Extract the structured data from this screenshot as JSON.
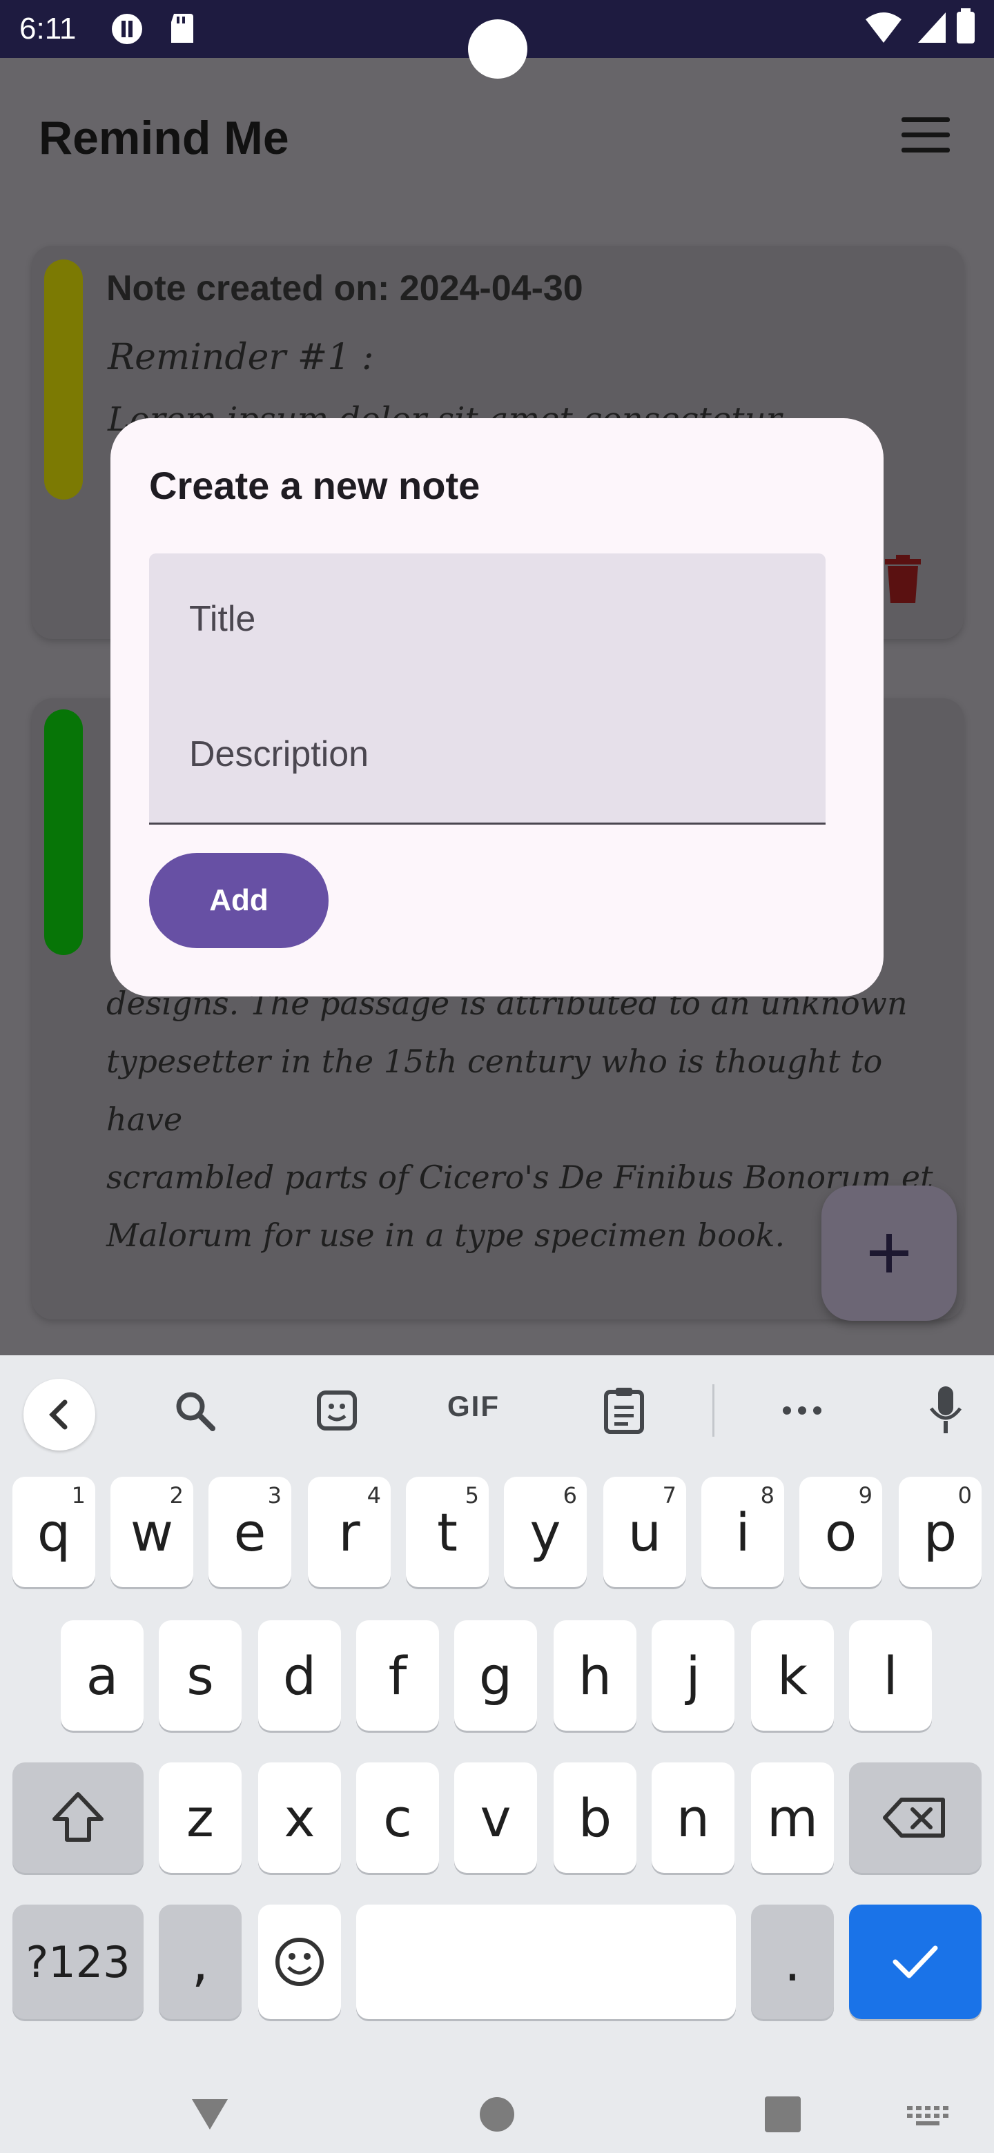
{
  "status_bar": {
    "time": "6:11"
  },
  "app": {
    "title": "Remind Me"
  },
  "notes": [
    {
      "heading": "Note created on: 2024-04-30",
      "reminder_label": "Reminder #1 :",
      "text": "Lorem ipsum dolor sit amet consectetur...",
      "color": "#7c7a03"
    },
    {
      "color": "#077507",
      "text_lines": [
        "designs. The passage is attributed to an unknown",
        "typesetter in the 15th century who is thought to have",
        "scrambled parts of Cicero's De Finibus Bonorum et",
        "Malorum for use in a type specimen book."
      ]
    }
  ],
  "fab": {
    "icon": "plus-icon",
    "label": "+"
  },
  "dialog": {
    "title": "Create a new note",
    "title_placeholder": "Title",
    "description_placeholder": "Description",
    "add_label": "Add"
  },
  "keyboard": {
    "gif_label": "GIF",
    "row1": [
      {
        "key": "q",
        "hint": "1"
      },
      {
        "key": "w",
        "hint": "2"
      },
      {
        "key": "e",
        "hint": "3"
      },
      {
        "key": "r",
        "hint": "4"
      },
      {
        "key": "t",
        "hint": "5"
      },
      {
        "key": "y",
        "hint": "6"
      },
      {
        "key": "u",
        "hint": "7"
      },
      {
        "key": "i",
        "hint": "8"
      },
      {
        "key": "o",
        "hint": "9"
      },
      {
        "key": "p",
        "hint": "0"
      }
    ],
    "row2": [
      "a",
      "s",
      "d",
      "f",
      "g",
      "h",
      "j",
      "k",
      "l"
    ],
    "row3": [
      "z",
      "x",
      "c",
      "v",
      "b",
      "n",
      "m"
    ],
    "symbols_label": "?123",
    "comma": ",",
    "period": "."
  },
  "colors": {
    "accent": "#6750a4",
    "enter_key": "#1a73e8",
    "delete": "#7a0f0f"
  }
}
